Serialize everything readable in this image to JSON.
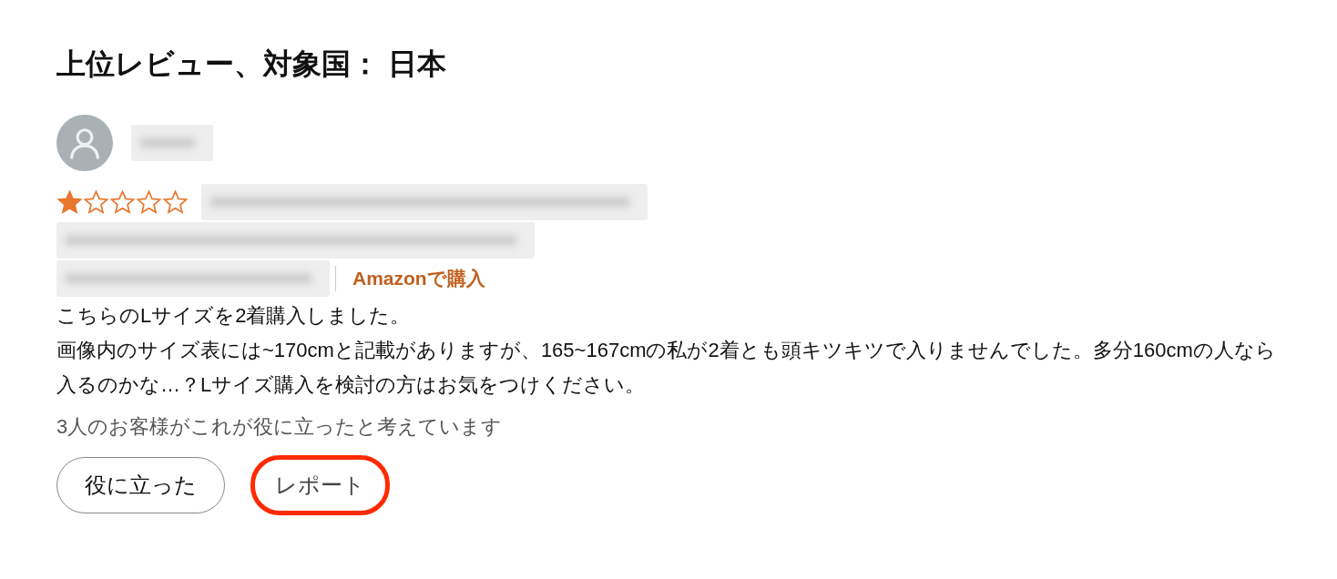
{
  "heading": "上位レビュー、対象国： 日本",
  "review": {
    "reviewer": {
      "redacted": true
    },
    "stars": 1,
    "title": {
      "redacted": true
    },
    "meta": [
      {
        "redacted": true
      },
      {
        "redacted": true
      }
    ],
    "verified": "Amazonで購入",
    "body": [
      "こちらのLサイズを2着購入しました。",
      "画像内のサイズ表には~170cmと記載がありますが、165~167cmの私が2着とも頭キツキツで入りませんでした。多分160cmの人なら入るのかな…？Lサイズ購入を検討の方はお気をつけください。"
    ],
    "helpful_count": "3人のお客様がこれが役に立ったと考えています",
    "buttons": [
      {
        "label": "役に立った",
        "highlighted": false
      },
      {
        "label": "レポート",
        "highlighted": true
      }
    ]
  }
}
